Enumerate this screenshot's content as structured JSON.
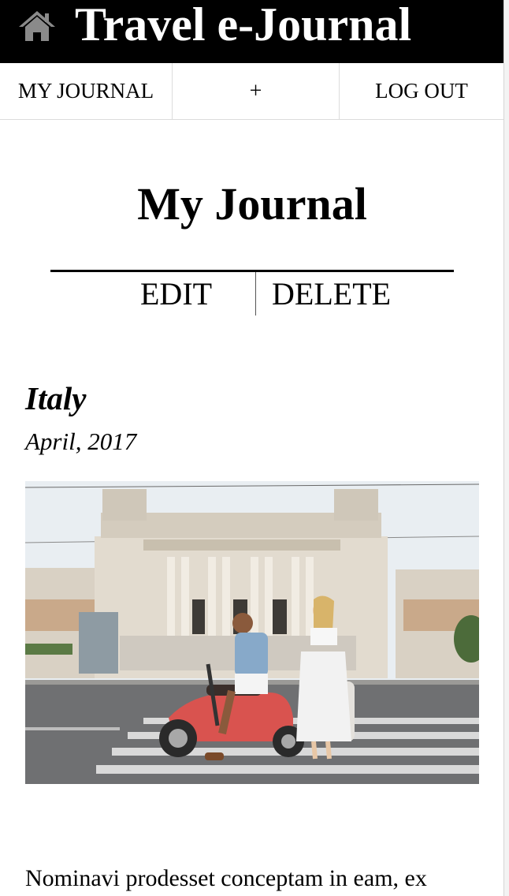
{
  "header": {
    "home_icon": "home-icon",
    "site_title": "Travel e-Journal"
  },
  "nav": {
    "my_journal": "MY JOURNAL",
    "add": "+",
    "log_out": "LOG OUT"
  },
  "main": {
    "page_title": "My Journal",
    "edit_label": "EDIT",
    "delete_label": "DELETE"
  },
  "entry": {
    "title": "Italy",
    "date": "April, 2017",
    "photo_icon": "travel-photo",
    "body": "Nominavi prodesset conceptam in eam, ex"
  },
  "colors": {
    "header_bg": "#000000",
    "header_text": "#ffffff",
    "text": "#000000",
    "divider": "#dcdcdc"
  }
}
